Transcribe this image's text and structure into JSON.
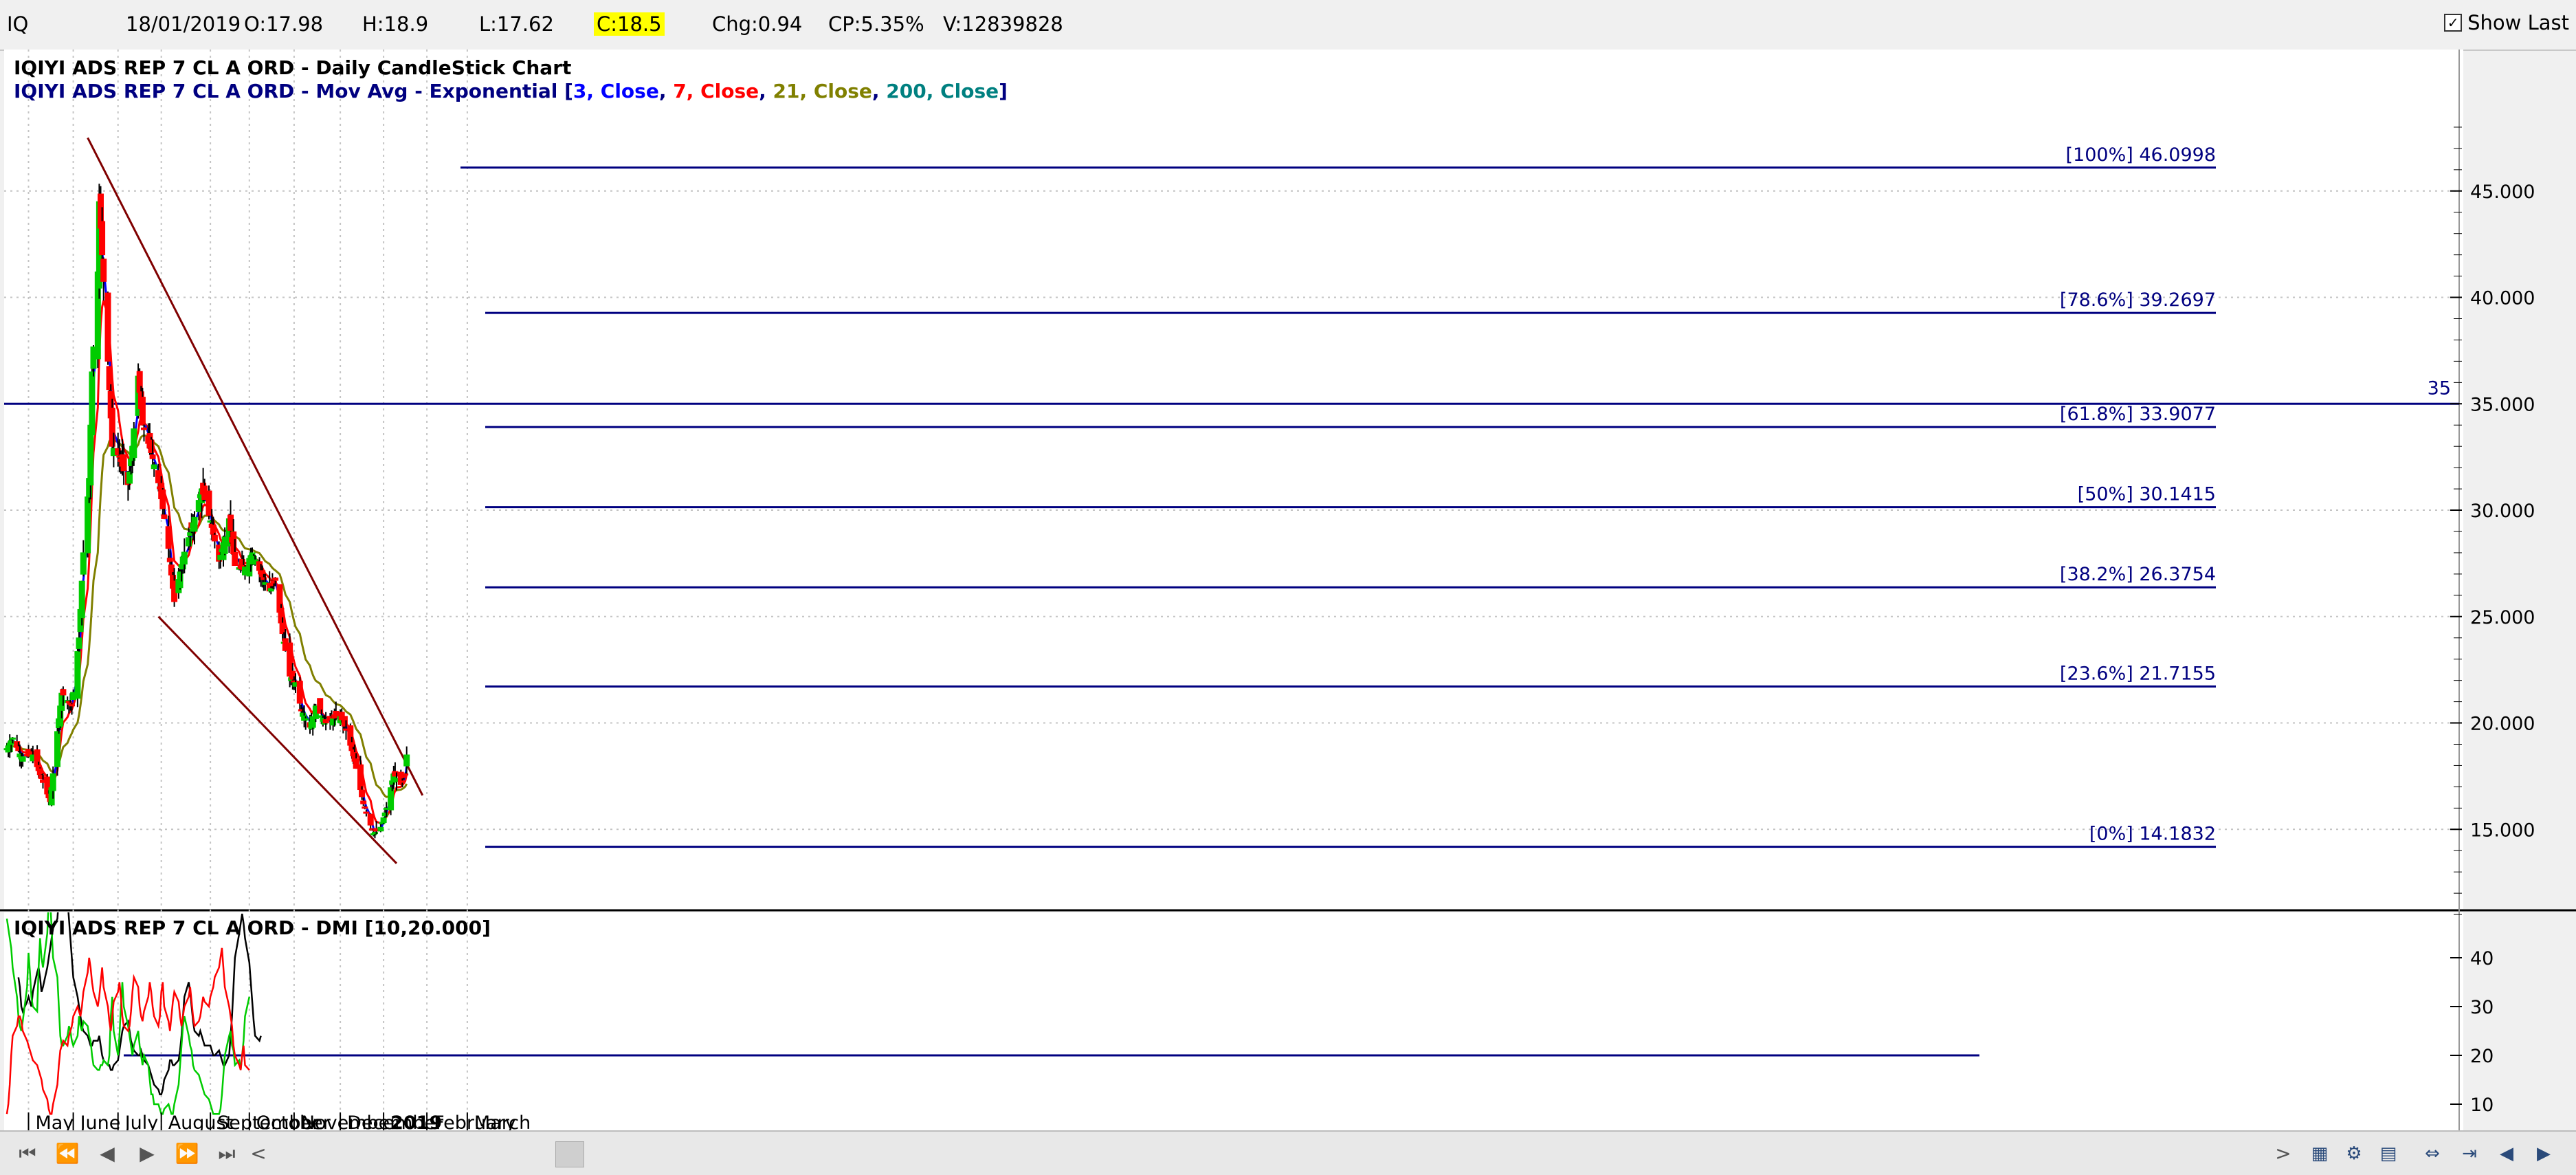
{
  "topbar": {
    "symbol": "IQ",
    "date": "18/01/2019",
    "open": "O:17.98",
    "high": "H:18.9",
    "low": "L:17.62",
    "close": "C:18.5",
    "chg": "Chg:0.94",
    "cp": "CP:5.35%",
    "volume": "V:12839828",
    "show_last": "Show Last"
  },
  "titles": {
    "main": "IQIYI ADS REP 7 CL A ORD - Daily CandleStick Chart",
    "ma_prefix": "IQIYI ADS REP 7 CL A ORD - Mov Avg - Exponential [",
    "ma_parts": [
      {
        "t": "3, Close",
        "c": "#0000ff"
      },
      {
        "t": ", ",
        "c": "#000080"
      },
      {
        "t": "7, Close",
        "c": "#ff0000"
      },
      {
        "t": ", ",
        "c": "#000080"
      },
      {
        "t": "21, Close",
        "c": "#808000"
      },
      {
        "t": ", ",
        "c": "#000080"
      },
      {
        "t": "200, Close",
        "c": "#008080"
      },
      {
        "t": "]",
        "c": "#000080"
      }
    ],
    "dmi": "IQIYI ADS REP 7 CL A ORD - DMI [10,20.000]"
  },
  "colors": {
    "up": "#00cc00",
    "down": "#ff0000",
    "ema3": "#0000ff",
    "ema7": "#ff0000",
    "ema21": "#808000",
    "fib": "#000080",
    "trend": "#800000",
    "adx": "#000000",
    "plus_di": "#00cc00",
    "minus_di": "#ff0000",
    "bg": "#ffffff"
  },
  "chart_data": [
    {
      "type": "candlestick",
      "title": "IQIYI ADS REP 7 CL A ORD - Daily CandleStick Chart",
      "y_ticks": [
        "15.000",
        "20.000",
        "25.000",
        "30.000",
        "35.000",
        "40.000",
        "45.000"
      ],
      "ylim": [
        10,
        49
      ],
      "x_labels": [
        "May",
        "June",
        "July",
        "August",
        "September",
        "October",
        "November",
        "December",
        "2019",
        "February",
        "March"
      ],
      "fib_levels": [
        {
          "label": "[100%] 46.0998",
          "value": 46.0998
        },
        {
          "label": "[78.6%] 39.2697",
          "value": 39.2697
        },
        {
          "label": "[61.8%] 33.9077",
          "value": 33.9077
        },
        {
          "label": "[50%] 30.1415",
          "value": 30.1415
        },
        {
          "label": "[38.2%] 26.3754",
          "value": 26.3754
        },
        {
          "label": "[23.6%] 21.7155",
          "value": 21.7155
        },
        {
          "label": "[0%] 14.1832",
          "value": 14.1832
        }
      ],
      "hline": {
        "label": "35",
        "value": 35
      },
      "trendlines": [
        {
          "x0": "2018-06-11",
          "y0": 47.5,
          "x1": "2019-01-29",
          "y1": 16.6
        },
        {
          "x0": "2018-07-30",
          "y0": 25.0,
          "x1": "2019-01-11",
          "y1": 13.4
        }
      ],
      "x0": "2018-04-16",
      "close_keypoints": [
        [
          "2018-04-16",
          18.8
        ],
        [
          "2018-04-20",
          19.3
        ],
        [
          "2018-04-26",
          18.4
        ],
        [
          "2018-05-04",
          18.5
        ],
        [
          "2018-05-11",
          17.2
        ],
        [
          "2018-05-16",
          16.3
        ],
        [
          "2018-05-21",
          19.6
        ],
        [
          "2018-05-24",
          21.4
        ],
        [
          "2018-05-31",
          20.8
        ],
        [
          "2018-06-05",
          24.0
        ],
        [
          "2018-06-08",
          28.0
        ],
        [
          "2018-06-12",
          31.5
        ],
        [
          "2018-06-14",
          36.5
        ],
        [
          "2018-06-18",
          41.2
        ],
        [
          "2018-06-19",
          44.5
        ],
        [
          "2018-06-21",
          42.0
        ],
        [
          "2018-06-25",
          37.0
        ],
        [
          "2018-06-28",
          33.0
        ],
        [
          "2018-07-03",
          32.5
        ],
        [
          "2018-07-09",
          31.2
        ],
        [
          "2018-07-12",
          33.0
        ],
        [
          "2018-07-16",
          36.3
        ],
        [
          "2018-07-19",
          34.0
        ],
        [
          "2018-07-25",
          32.7
        ],
        [
          "2018-07-31",
          31.0
        ],
        [
          "2018-08-06",
          28.2
        ],
        [
          "2018-08-10",
          25.7
        ],
        [
          "2018-08-16",
          27.8
        ],
        [
          "2018-08-23",
          29.4
        ],
        [
          "2018-08-29",
          31.0
        ],
        [
          "2018-09-04",
          29.5
        ],
        [
          "2018-09-10",
          27.6
        ],
        [
          "2018-09-17",
          29.6
        ],
        [
          "2018-09-21",
          27.4
        ],
        [
          "2018-09-27",
          27.2
        ],
        [
          "2018-10-03",
          28.0
        ],
        [
          "2018-10-09",
          27.0
        ],
        [
          "2018-10-15",
          26.2
        ],
        [
          "2018-10-19",
          26.7
        ],
        [
          "2018-10-24",
          24.2
        ],
        [
          "2018-10-29",
          22.2
        ],
        [
          "2018-11-02",
          21.9
        ],
        [
          "2018-11-06",
          20.6
        ],
        [
          "2018-11-12",
          19.8
        ],
        [
          "2018-11-16",
          20.8
        ],
        [
          "2018-11-23",
          20.0
        ],
        [
          "2018-11-28",
          20.2
        ],
        [
          "2018-12-03",
          20.3
        ],
        [
          "2018-12-07",
          19.7
        ],
        [
          "2018-12-13",
          18.2
        ],
        [
          "2018-12-19",
          16.2
        ],
        [
          "2018-12-26",
          14.8
        ],
        [
          "2018-12-31",
          15.1
        ],
        [
          "2019-01-04",
          16.0
        ],
        [
          "2019-01-09",
          17.6
        ],
        [
          "2019-01-14",
          17.1
        ],
        [
          "2019-01-17",
          17.6
        ],
        [
          "2019-01-18",
          18.5
        ]
      ],
      "last_bar": {
        "date": "2019-01-18",
        "open": 17.98,
        "high": 18.9,
        "low": 17.62,
        "close": 18.5
      }
    },
    {
      "type": "line",
      "title": "IQIYI ADS REP 7 CL A ORD - DMI [10,20.000]",
      "y_ticks": [
        "10",
        "20",
        "30",
        "40"
      ],
      "ylim": [
        8,
        50
      ],
      "threshold": 20,
      "series": [
        {
          "key": "adx",
          "x0": "2018-04-24",
          "values": [
            36,
            34,
            30,
            29,
            31,
            32,
            31,
            30,
            33,
            37,
            38,
            36,
            33,
            34,
            38,
            40,
            42,
            44,
            46,
            48,
            52,
            56,
            58,
            56,
            52,
            48,
            44,
            40,
            36,
            32,
            30,
            28,
            26,
            25,
            24,
            23,
            22,
            22,
            23,
            23,
            24,
            22,
            20,
            19,
            18,
            18,
            17,
            17,
            18,
            19,
            21,
            23,
            25,
            26,
            27,
            25,
            23,
            22,
            21,
            20,
            20,
            21,
            20,
            19,
            18,
            17,
            16,
            15,
            14,
            13,
            12,
            12,
            13,
            15,
            17,
            19,
            19,
            18,
            18,
            19,
            21,
            24,
            28,
            32,
            35,
            33,
            30,
            27,
            25,
            24,
            25,
            24,
            23,
            22,
            22,
            22,
            21,
            20,
            20,
            21,
            20,
            19,
            18,
            18,
            20,
            24,
            28,
            34,
            40,
            45,
            47,
            49,
            47,
            44,
            39,
            35,
            31,
            27,
            24,
            23,
            24
          ]
        },
        {
          "key": "plus_di",
          "x0": "2018-04-16",
          "values": [
            48,
            46,
            44,
            42,
            38,
            32,
            28,
            26,
            25,
            27,
            34,
            41,
            37,
            32,
            30,
            29,
            38,
            44,
            40,
            38,
            45,
            52,
            54,
            46,
            40,
            36,
            30,
            24,
            22,
            22,
            24,
            26,
            25,
            23,
            22,
            24,
            28,
            26,
            25,
            27,
            26,
            24,
            23,
            20,
            18,
            17,
            17,
            18,
            18,
            19,
            18,
            20,
            28,
            32,
            25,
            20,
            24,
            30,
            35,
            30,
            26,
            24,
            22,
            20,
            22,
            25,
            22,
            20,
            18,
            20,
            18,
            15,
            12,
            12,
            10,
            10,
            9,
            8,
            8,
            9,
            10,
            9,
            8,
            8,
            10,
            14,
            18,
            22,
            26,
            28,
            24,
            22,
            21,
            18,
            17,
            16,
            15,
            14,
            13,
            12,
            11,
            10,
            9,
            8,
            8,
            8,
            9,
            12,
            16,
            20,
            24,
            25,
            22,
            21,
            18,
            19,
            17,
            20,
            23,
            28,
            32
          ]
        },
        {
          "key": "minus_di",
          "x0": "2018-04-16",
          "values": [
            8,
            10,
            14,
            20,
            24,
            26,
            28,
            28,
            27,
            25,
            23,
            22,
            21,
            20,
            19,
            18,
            17,
            16,
            15,
            13,
            11,
            9,
            8,
            8,
            10,
            14,
            18,
            21,
            22,
            23,
            22,
            24,
            25,
            26,
            28,
            30,
            29,
            28,
            30,
            33,
            37,
            40,
            38,
            35,
            33,
            30,
            32,
            35,
            38,
            34,
            30,
            27,
            25,
            28,
            31,
            33,
            35,
            32,
            28,
            26,
            25,
            26,
            29,
            33,
            36,
            34,
            30,
            28,
            27,
            29,
            32,
            35,
            33,
            30,
            28,
            26,
            28,
            33,
            35,
            30,
            27,
            25,
            28,
            31,
            33,
            31,
            28,
            26,
            28,
            30,
            32,
            34,
            31,
            28,
            26,
            27,
            28,
            30,
            32,
            31,
            30,
            32,
            33,
            34,
            36,
            38,
            40,
            42,
            38,
            34,
            30,
            28,
            26,
            22,
            20,
            18,
            17,
            20,
            22,
            18,
            17
          ]
        }
      ]
    }
  ],
  "nav": {
    "scroll_left": "<",
    "scroll_right": ">"
  }
}
